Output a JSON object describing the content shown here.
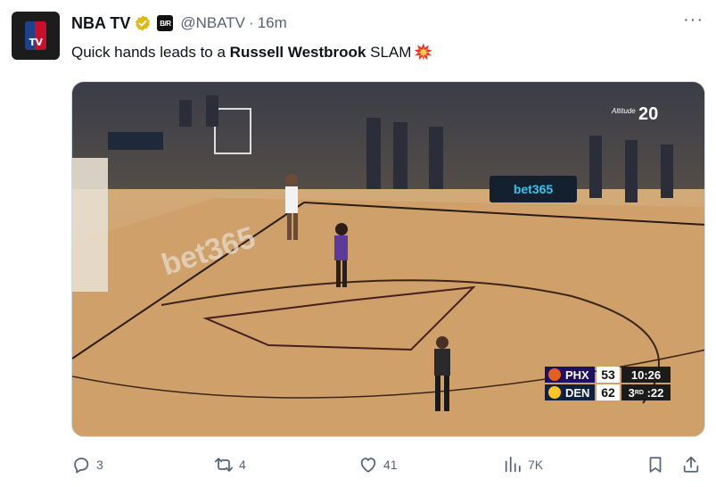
{
  "author": {
    "name": "NBA TV",
    "handle": "@NBATV",
    "separator": "·",
    "time": "16m",
    "avatar_label": "TV",
    "affiliate_badge": "B/R",
    "verified_icon": "verified-gold-check"
  },
  "tweet": {
    "text_before": "Quick hands leads to a ",
    "text_bold": "Russell Westbrook",
    "text_after": " SLAM",
    "emoji": "collision-emoji"
  },
  "media": {
    "arena_ad": "bet365",
    "court_text": "bet365",
    "altitude_logo": "Altitude",
    "altitude_years": "20",
    "scorebug": {
      "team1": "PHX",
      "score1": "53",
      "team2": "DEN",
      "score2": "62",
      "clock": "10:26",
      "quarter": "3",
      "quarter_suffix": "RD",
      "shot_clock": ":22",
      "colors": {
        "phx": "#1d1160",
        "den": "#0e2240",
        "phx_logo": "#e56020",
        "den_logo": "#fec524"
      }
    }
  },
  "actions": {
    "replies": "3",
    "reposts": "4",
    "likes": "41",
    "views": "7K"
  },
  "more_label": "···"
}
